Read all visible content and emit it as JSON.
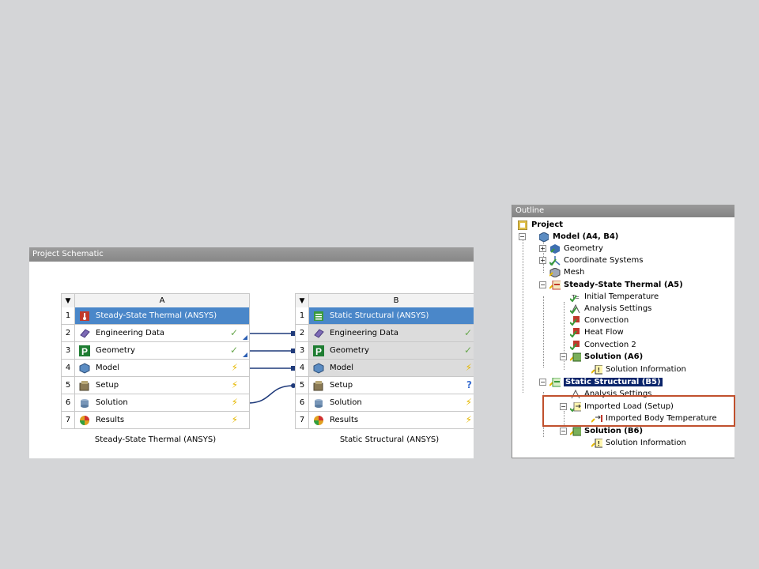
{
  "schematic": {
    "title": "Project Schematic",
    "systems": [
      {
        "column": "A",
        "header": "Steady-State Thermal (ANSYS)",
        "name": "Steady-State Thermal (ANSYS)",
        "rows": [
          {
            "num": "2",
            "label": "Engineering Data",
            "status": "✓",
            "status_kind": "ok"
          },
          {
            "num": "3",
            "label": "Geometry",
            "status": "✓",
            "status_kind": "ok"
          },
          {
            "num": "4",
            "label": "Model",
            "status": "⚡",
            "status_kind": "bolt"
          },
          {
            "num": "5",
            "label": "Setup",
            "status": "⚡",
            "status_kind": "bolt"
          },
          {
            "num": "6",
            "label": "Solution",
            "status": "⚡",
            "status_kind": "bolt"
          },
          {
            "num": "7",
            "label": "Results",
            "status": "⚡",
            "status_kind": "bolt"
          }
        ]
      },
      {
        "column": "B",
        "header": "Static Structural (ANSYS)",
        "name": "Static Structural (ANSYS)",
        "rows": [
          {
            "num": "2",
            "label": "Engineering Data",
            "status": "✓",
            "status_kind": "ok"
          },
          {
            "num": "3",
            "label": "Geometry",
            "status": "✓",
            "status_kind": "ok"
          },
          {
            "num": "4",
            "label": "Model",
            "status": "⚡",
            "status_kind": "bolt"
          },
          {
            "num": "5",
            "label": "Setup",
            "status": "?",
            "status_kind": "q"
          },
          {
            "num": "6",
            "label": "Solution",
            "status": "⚡",
            "status_kind": "bolt"
          },
          {
            "num": "7",
            "label": "Results",
            "status": "⚡",
            "status_kind": "bolt"
          }
        ]
      }
    ],
    "header_num": "1",
    "arrow": "▼"
  },
  "outline": {
    "title": "Outline",
    "nodes": {
      "project": "Project",
      "model": "Model (A4, B4)",
      "geometry": "Geometry",
      "coord": "Coordinate Systems",
      "mesh": "Mesh",
      "thermal": "Steady-State Thermal (A5)",
      "init_temp": "Initial Temperature",
      "analysis_a": "Analysis Settings",
      "convection": "Convection",
      "heat_flow": "Heat Flow",
      "convection2": "Convection 2",
      "solution_a6": "Solution (A6)",
      "sol_info_a": "Solution Information",
      "structural": "Static Structural (B5)",
      "analysis_b": "Analysis Settings",
      "imported_load": "Imported Load (Setup)",
      "imported_temp": "Imported Body Temperature",
      "solution_b6": "Solution (B6)",
      "sol_info_b": "Solution Information"
    }
  }
}
